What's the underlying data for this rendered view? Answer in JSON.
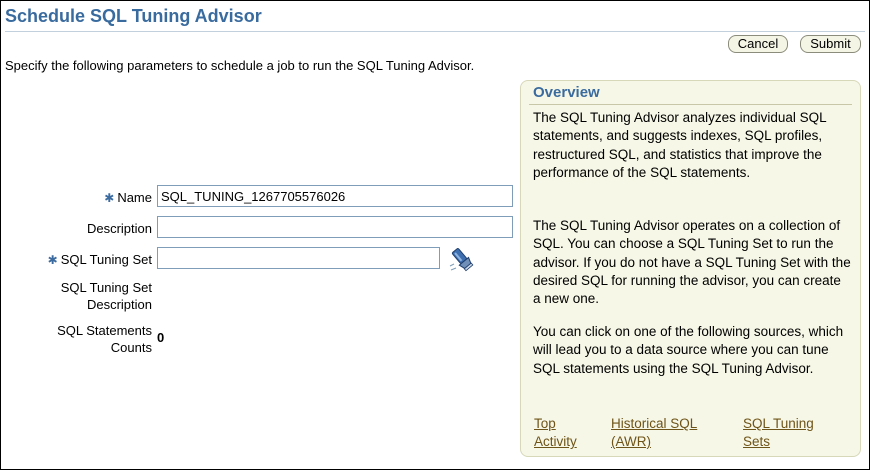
{
  "page": {
    "title": "Schedule SQL Tuning Advisor",
    "intro": "Specify the following parameters to schedule a job to run the SQL Tuning Advisor."
  },
  "buttons": {
    "cancel": "Cancel",
    "submit": "Submit"
  },
  "form": {
    "required_marker": "✱",
    "name_label": "Name",
    "name_value": "SQL_TUNING_1267705576026",
    "description_label": "Description",
    "description_value": "",
    "sts_label": "SQL Tuning Set",
    "sts_value": "",
    "sts_desc_label_1": "SQL Tuning Set",
    "sts_desc_label_2": "Description",
    "stmt_count_label_1": "SQL Statements",
    "stmt_count_label_2": "Counts",
    "stmt_count_value": "0",
    "search_icon": "flashlight-search-icon"
  },
  "overview": {
    "title": "Overview",
    "p1": "The SQL Tuning Advisor analyzes individual SQL statements, and suggests indexes, SQL profiles, restructured SQL, and statistics that improve the performance of the SQL statements.",
    "p2": "The SQL Tuning Advisor operates on a collection of SQL. You can choose a SQL Tuning Set to run the advisor. If you do not have a SQL Tuning Set with the desired SQL for running the advisor, you can create a new one.",
    "p3": "You can click on one of the following sources, which will lead you to a data source where you can tune SQL statements using the SQL Tuning Advisor.",
    "links": {
      "top_activity_1": "Top",
      "top_activity_2": "Activity",
      "historical_1": "Historical SQL",
      "historical_2": "(AWR)",
      "sts_1": "SQL Tuning",
      "sts_2": "Sets"
    }
  },
  "colors": {
    "title_blue": "#3a6b9f",
    "panel_bg": "#f7f7e7",
    "link_brown": "#6e5418"
  }
}
